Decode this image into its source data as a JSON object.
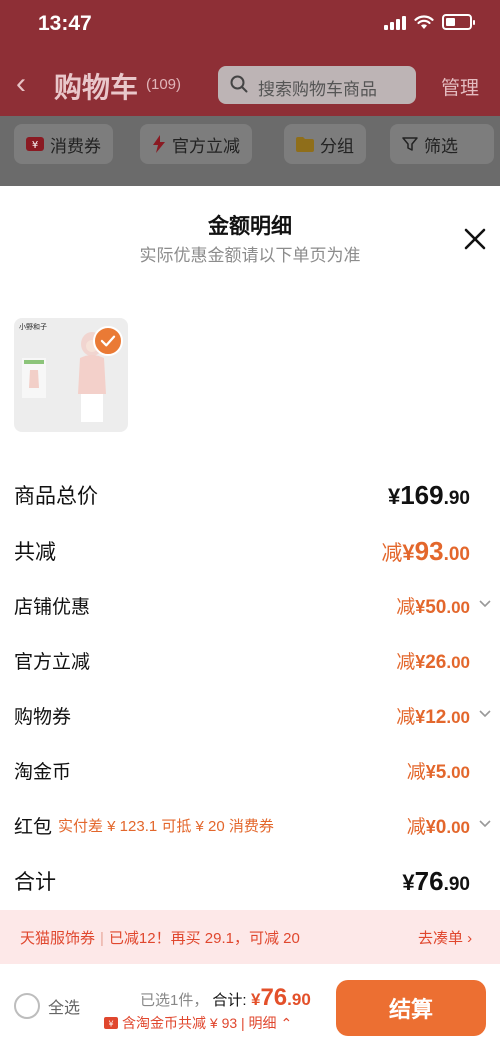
{
  "status": {
    "time": "13:47"
  },
  "nav": {
    "title": "购物车",
    "count": "(109)",
    "search_placeholder": "搜索购物车商品",
    "manage": "管理"
  },
  "filters": [
    {
      "label": "消费券",
      "icon": "ticket-icon"
    },
    {
      "label": "官方立减",
      "icon": "lightning-icon"
    },
    {
      "label": "分组",
      "icon": "folder-icon"
    },
    {
      "label": "筛选",
      "icon": "filter-icon"
    }
  ],
  "sheet": {
    "title": "金额明细",
    "subtitle": "实际优惠金额请以下单页为准",
    "product": {
      "brand": "小野和子",
      "selected": true
    },
    "rows": [
      {
        "label": "商品总价",
        "prefix": "",
        "currency": "¥",
        "int": "169",
        "dec": ".90",
        "style": "dark",
        "chevron": false
      },
      {
        "label": "共减",
        "prefix": "减",
        "currency": "¥",
        "int": "93",
        "dec": ".00",
        "style": "accent-large",
        "chevron": false
      },
      {
        "label": "店铺优惠",
        "prefix": "减",
        "currency": "¥",
        "int": "50",
        "dec": ".00",
        "style": "accent",
        "chevron": true
      },
      {
        "label": "官方立减",
        "prefix": "减",
        "currency": "¥",
        "int": "26",
        "dec": ".00",
        "style": "accent",
        "chevron": false
      },
      {
        "label": "购物券",
        "prefix": "减",
        "currency": "¥",
        "int": "12",
        "dec": ".00",
        "style": "accent",
        "chevron": true
      },
      {
        "label": "淘金币",
        "prefix": "减",
        "currency": "¥",
        "int": "5",
        "dec": ".00",
        "style": "accent",
        "chevron": false
      },
      {
        "label": "红包",
        "note": "实付差 ¥ 123.1 可抵 ¥ 20 消费券",
        "prefix": "减",
        "currency": "¥",
        "int": "0",
        "dec": ".00",
        "style": "accent",
        "chevron": true
      },
      {
        "label": "合计",
        "prefix": "",
        "currency": "¥",
        "int": "76",
        "dec": ".90",
        "style": "dark-large",
        "chevron": false
      }
    ]
  },
  "promo": {
    "name": "天猫服饰券",
    "desc": "已减12！再买 29.1，可减 20",
    "link": "去凑单 ›"
  },
  "bottom": {
    "select_all": "全选",
    "selected_text": "已选1件，",
    "total_label": "合计:",
    "total_currency": "¥",
    "total_int": "76",
    "total_dec": ".90",
    "subsidy_text": "含淘金币共减 ¥ 93 | 明细 ⌃",
    "checkout": "结算"
  },
  "colors": {
    "accent": "#e3672c",
    "checkout": "#ec6f32",
    "promo_bg": "#fde8e8",
    "header_bg": "#8e2f36"
  }
}
